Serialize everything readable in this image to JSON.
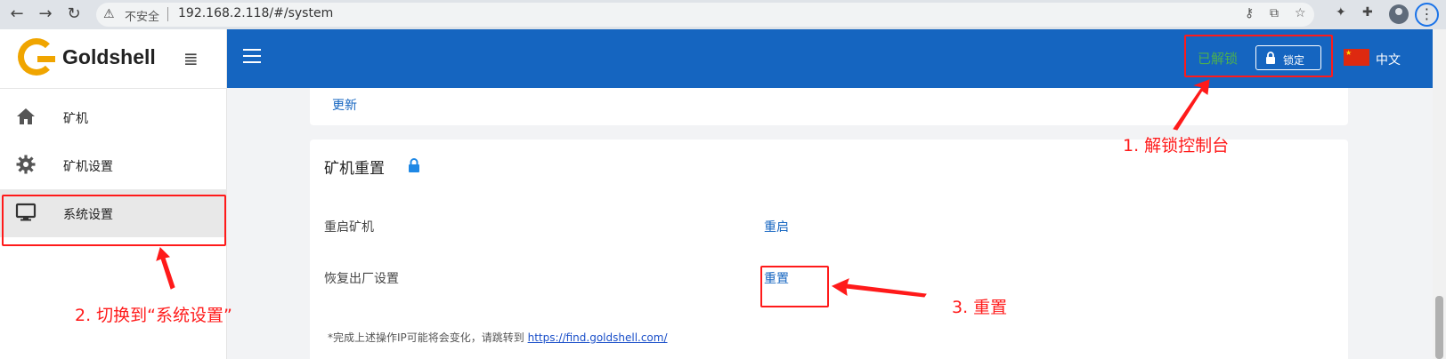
{
  "browser": {
    "insecure_label": "不安全",
    "url": "192.168.2.118/#/system"
  },
  "sidebar": {
    "brand": "Goldshell",
    "items": [
      {
        "label": "矿机",
        "icon": "home-icon"
      },
      {
        "label": "矿机设置",
        "icon": "gear-icon"
      },
      {
        "label": "系统设置",
        "icon": "monitor-icon"
      }
    ]
  },
  "topbar": {
    "unlock_status": "已解锁",
    "lock_button": "锁定",
    "language": "中文"
  },
  "content": {
    "update_link": "更新",
    "reset_section": {
      "title": "矿机重置",
      "rows": [
        {
          "label": "重启矿机",
          "action": "重启"
        },
        {
          "label": "恢复出厂设置",
          "action": "重置"
        }
      ],
      "note_prefix": "*完成上述操作IP可能将会变化，请跳转到 ",
      "note_link": "https://find.goldshell.com/"
    }
  },
  "annotations": {
    "step1": "1. 解锁控制台",
    "step2": "2. 切换到“系统设置”",
    "step3": "3. 重置"
  },
  "colors": {
    "topbar": "#1565c0",
    "annotation": "#ff1a1a",
    "unlock_green": "#4caf50",
    "brand_gold": "#f0a500"
  }
}
